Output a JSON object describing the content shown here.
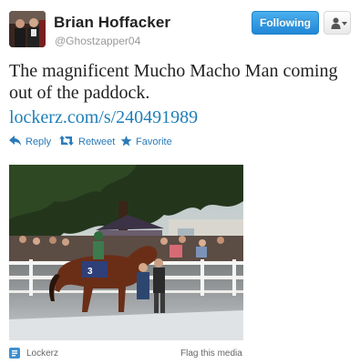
{
  "user": {
    "display_name": "Brian Hoffacker",
    "handle": "@Ghostzapper04",
    "avatar_icon": "user-avatar-photo"
  },
  "header": {
    "follow_label": "Following",
    "menu_icon": "person-icon",
    "caret_icon": "caret-down-icon"
  },
  "tweet": {
    "text": "The magnificent Mucho Macho Man coming out of the paddock.",
    "link": "lockerz.com/s/240491989"
  },
  "actions": [
    {
      "icon": "reply-icon",
      "label": "Reply"
    },
    {
      "icon": "retweet-icon",
      "label": "Retweet"
    },
    {
      "icon": "star-icon",
      "label": "Favorite"
    }
  ],
  "media": {
    "description_icon": "horse-photo",
    "source_icon": "lockerz-icon",
    "source_name": "Lockerz",
    "flag_label": "Flag this media"
  },
  "colors": {
    "accent": "#2b7bb9",
    "follow_button": "#2287d6",
    "link": "#1d7fb8",
    "text": "#222222",
    "muted": "#999999"
  }
}
